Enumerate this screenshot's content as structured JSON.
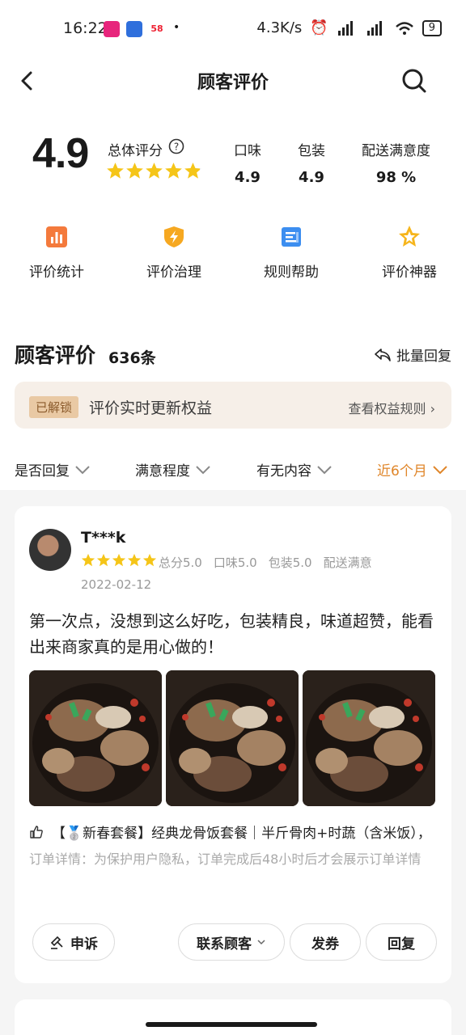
{
  "status": {
    "time": "16:22",
    "network_speed": "4.3K/s",
    "battery": "9",
    "app1_color": "#e7257c",
    "app2_color": "#2f6fdc",
    "app3_label": "58"
  },
  "header": {
    "title": "顾客评价"
  },
  "summary": {
    "overall_score": "4.9",
    "overall_label": "总体评分",
    "overall_rating": 4.9,
    "metrics": [
      {
        "label": "口味",
        "value": "4.9"
      },
      {
        "label": "包装",
        "value": "4.9"
      },
      {
        "label": "配送满意度",
        "value": "98 %"
      }
    ]
  },
  "tools": [
    {
      "label": "评价统计",
      "icon": "bar-chart-icon"
    },
    {
      "label": "评价治理",
      "icon": "shield-bolt-icon"
    },
    {
      "label": "规则帮助",
      "icon": "document-icon"
    },
    {
      "label": "评价神器",
      "icon": "star-badge-icon"
    }
  ],
  "reviews_section": {
    "title": "顾客评价",
    "count": "636条",
    "batch_reply": "批量回复"
  },
  "banner": {
    "badge": "已解锁",
    "text": "评价实时更新权益",
    "link": "查看权益规则 ›"
  },
  "filters": [
    {
      "label": "是否回复",
      "active": false
    },
    {
      "label": "满意程度",
      "active": false
    },
    {
      "label": "有无内容",
      "active": false
    },
    {
      "label": "近6个月",
      "active": true
    }
  ],
  "review": {
    "user": "T***k",
    "rating": 5,
    "sub_scores": [
      "总分5.0",
      "口味5.0",
      "包装5.0",
      "配送满意"
    ],
    "date": "2022-02-12",
    "text": "第一次点，没想到这么好吃，包装精良，味道超赞，能看出来商家真的是用心做的！",
    "photo_count": 3,
    "dish": "【🥈新春套餐】经典龙骨饭套餐｜半斤骨肉+时蔬（含米饭），",
    "order_detail": "订单详情：为保护用户隐私，订单完成后48小时后才会展示订单详情"
  },
  "actions": {
    "appeal": "申诉",
    "contact": "联系顾客",
    "coupon": "发券",
    "reply": "回复"
  },
  "colors": {
    "star": "#f5c518",
    "accent": "#e0862a",
    "muted": "#999999"
  }
}
